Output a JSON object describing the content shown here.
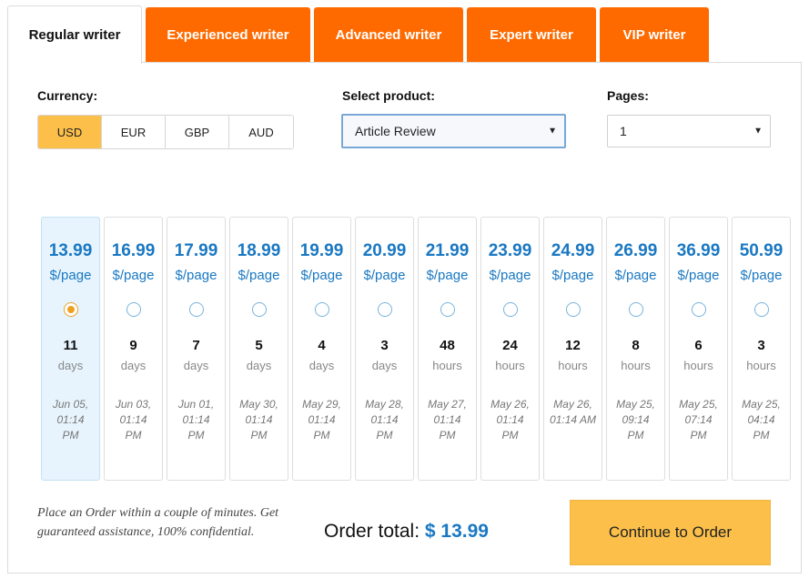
{
  "tabs": [
    {
      "label": "Regular writer",
      "active": true
    },
    {
      "label": "Experienced writer",
      "active": false
    },
    {
      "label": "Advanced writer",
      "active": false
    },
    {
      "label": "Expert writer",
      "active": false
    },
    {
      "label": "VIP writer",
      "active": false
    }
  ],
  "currency": {
    "label": "Currency:",
    "options": [
      "USD",
      "EUR",
      "GBP",
      "AUD"
    ],
    "selected": "USD"
  },
  "product": {
    "label": "Select product:",
    "value": "Article Review"
  },
  "pages": {
    "label": "Pages:",
    "value": "1"
  },
  "deadlines": [
    {
      "price": "13.99",
      "per": "$/page",
      "amount": "11",
      "unit": "days",
      "date_line1": "Jun 05,",
      "date_line2": "01:14",
      "date_line3": "PM",
      "selected": true
    },
    {
      "price": "16.99",
      "per": "$/page",
      "amount": "9",
      "unit": "days",
      "date_line1": "Jun 03,",
      "date_line2": "01:14",
      "date_line3": "PM",
      "selected": false
    },
    {
      "price": "17.99",
      "per": "$/page",
      "amount": "7",
      "unit": "days",
      "date_line1": "Jun 01,",
      "date_line2": "01:14",
      "date_line3": "PM",
      "selected": false
    },
    {
      "price": "18.99",
      "per": "$/page",
      "amount": "5",
      "unit": "days",
      "date_line1": "May 30,",
      "date_line2": "01:14",
      "date_line3": "PM",
      "selected": false
    },
    {
      "price": "19.99",
      "per": "$/page",
      "amount": "4",
      "unit": "days",
      "date_line1": "May 29,",
      "date_line2": "01:14",
      "date_line3": "PM",
      "selected": false
    },
    {
      "price": "20.99",
      "per": "$/page",
      "amount": "3",
      "unit": "days",
      "date_line1": "May 28,",
      "date_line2": "01:14",
      "date_line3": "PM",
      "selected": false
    },
    {
      "price": "21.99",
      "per": "$/page",
      "amount": "48",
      "unit": "hours",
      "date_line1": "May 27,",
      "date_line2": "01:14",
      "date_line3": "PM",
      "selected": false
    },
    {
      "price": "23.99",
      "per": "$/page",
      "amount": "24",
      "unit": "hours",
      "date_line1": "May 26,",
      "date_line2": "01:14",
      "date_line3": "PM",
      "selected": false
    },
    {
      "price": "24.99",
      "per": "$/page",
      "amount": "12",
      "unit": "hours",
      "date_line1": "May 26,",
      "date_line2": "01:14 AM",
      "date_line3": "",
      "selected": false
    },
    {
      "price": "26.99",
      "per": "$/page",
      "amount": "8",
      "unit": "hours",
      "date_line1": "May 25,",
      "date_line2": "09:14",
      "date_line3": "PM",
      "selected": false
    },
    {
      "price": "36.99",
      "per": "$/page",
      "amount": "6",
      "unit": "hours",
      "date_line1": "May 25,",
      "date_line2": "07:14",
      "date_line3": "PM",
      "selected": false
    },
    {
      "price": "50.99",
      "per": "$/page",
      "amount": "3",
      "unit": "hours",
      "date_line1": "May 25,",
      "date_line2": "04:14",
      "date_line3": "PM",
      "selected": false
    }
  ],
  "footer": {
    "note": "Place an Order within a couple of minutes. Get guaranteed assistance, 100% confidential.",
    "total_label": "Order total:",
    "total_value": "$ 13.99",
    "continue_label": "Continue to Order"
  },
  "colors": {
    "tab_orange": "#ff6a00",
    "accent_yellow": "#fcc04a",
    "price_blue": "#1a78c2",
    "selected_card_bg": "#e7f4fd"
  }
}
